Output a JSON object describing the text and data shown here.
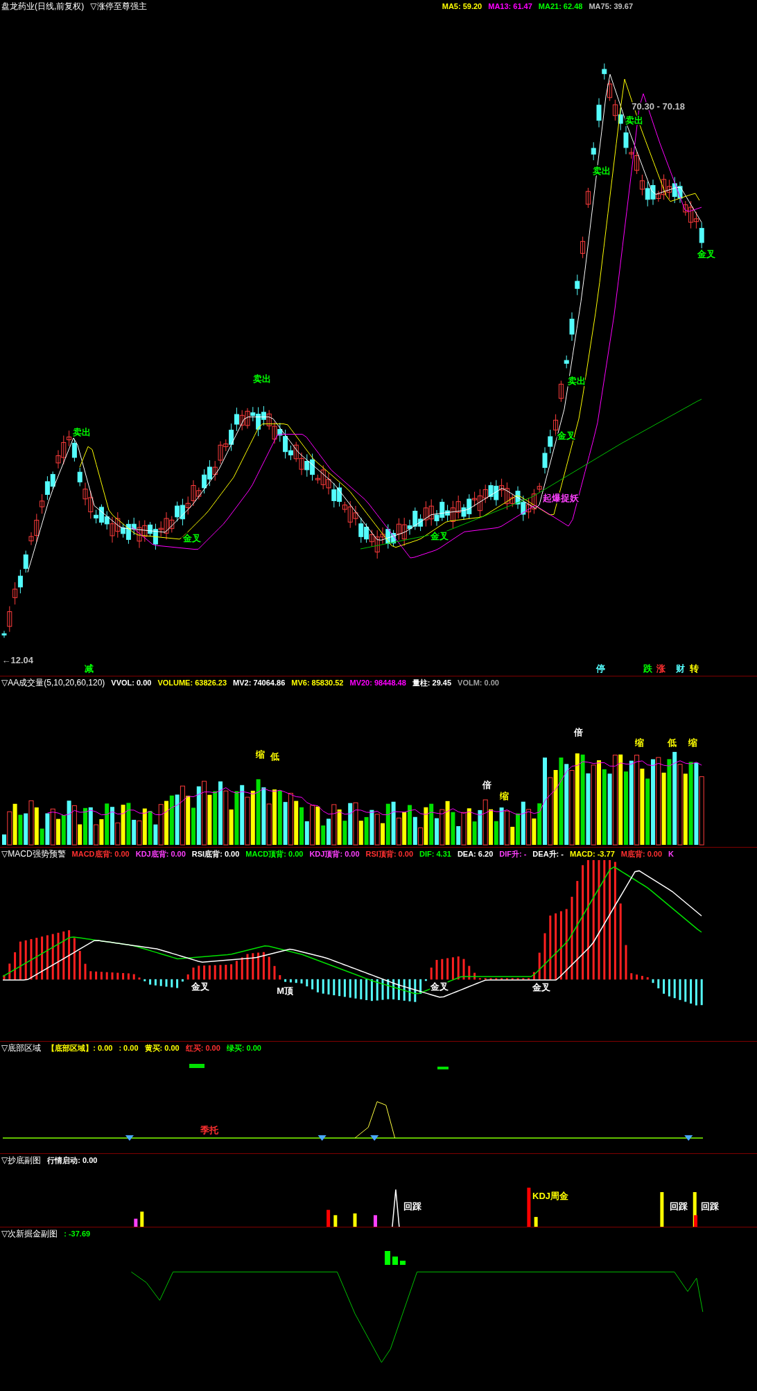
{
  "main_chart": {
    "title": "盘龙药业(日线,前复权)",
    "indicator": "▽涨停至尊强主",
    "legend": [
      {
        "label": "MA5: 59.20",
        "color": "#ffff00"
      },
      {
        "label": "MA13: 61.47",
        "color": "#ff00ff"
      },
      {
        "label": "MA21: 62.48",
        "color": "#00ff00"
      },
      {
        "label": "MA75: 39.67",
        "color": "#c0c0c0"
      }
    ],
    "annotations": [
      {
        "text": "卖出",
        "color": "#00ff00"
      },
      {
        "text": "卖出",
        "color": "#00ff00"
      },
      {
        "text": "卖出",
        "color": "#00ff00"
      },
      {
        "text": "卖出",
        "color": "#00ff00"
      },
      {
        "text": "卖出",
        "color": "#00ff00"
      },
      {
        "text": "金叉",
        "color": "#00ff00"
      },
      {
        "text": "金叉",
        "color": "#00ff00"
      },
      {
        "text": "金叉",
        "color": "#00ff00"
      },
      {
        "text": "金叉",
        "color": "#00ff00"
      },
      {
        "text": "起爆捉妖",
        "color": "#ff40ff"
      },
      {
        "text": "70.30 - 70.18",
        "color": "#c0c0c0"
      },
      {
        "text": "←12.04",
        "color": "#c0c0c0"
      },
      {
        "text": "减",
        "color": "#00ff00"
      },
      {
        "text": "停",
        "color": "#54fcfc"
      },
      {
        "text": "跌",
        "color": "#00ff00"
      },
      {
        "text": "涨",
        "color": "#ff3030"
      },
      {
        "text": "财",
        "color": "#54fcfc"
      },
      {
        "text": "转",
        "color": "#ffff00"
      }
    ]
  },
  "panes": [
    {
      "kind": "volume",
      "title": "▽AA成交量(5,10,20,60,120)",
      "legend": [
        {
          "label": "VVOL: 0.00",
          "color": "#ffffff"
        },
        {
          "label": "VOLUME: 63826.23",
          "color": "#ffff00"
        },
        {
          "label": "MV2: 74064.86",
          "color": "#ffffff"
        },
        {
          "label": "MV6: 85830.52",
          "color": "#ffff00"
        },
        {
          "label": "MV20: 98448.48",
          "color": "#ff00ff"
        },
        {
          "label": "量柱: 29.45",
          "color": "#ffffff"
        },
        {
          "label": "VOLM: 0.00",
          "color": "#a0a0a0"
        }
      ],
      "annotations": [
        {
          "text": "倍",
          "color": "#ffffff"
        },
        {
          "text": "缩",
          "color": "#ffff00"
        },
        {
          "text": "缩",
          "color": "#ffff00"
        },
        {
          "text": "缩",
          "color": "#ffff00"
        },
        {
          "text": "倍",
          "color": "#ffffff"
        },
        {
          "text": "缩",
          "color": "#ffff00"
        },
        {
          "text": "低",
          "color": "#ffff00"
        },
        {
          "text": "低",
          "color": "#ffff00"
        }
      ]
    },
    {
      "kind": "macd",
      "title": "▽MACD强势预警",
      "legend": [
        {
          "label": "MACD底背: 0.00",
          "color": "#ff3030"
        },
        {
          "label": "KDJ底背: 0.00",
          "color": "#ff40ff"
        },
        {
          "label": "RSI底背: 0.00",
          "color": "#ffffff"
        },
        {
          "label": "MACD顶背: 0.00",
          "color": "#00ff00"
        },
        {
          "label": "KDJ顶背: 0.00",
          "color": "#ff40ff"
        },
        {
          "label": "RSI顶背: 0.00",
          "color": "#ff3030"
        },
        {
          "label": "DIF: 4.31",
          "color": "#00ff00"
        },
        {
          "label": "DEA: 6.20",
          "color": "#ffffff"
        },
        {
          "label": "DIF升: -",
          "color": "#ff40ff"
        },
        {
          "label": "DEA升: -",
          "color": "#ffffff"
        },
        {
          "label": "MACD: -3.77",
          "color": "#ffff00"
        },
        {
          "label": "M底背: 0.00",
          "color": "#ff3030"
        },
        {
          "label": "K",
          "color": "#ff40ff"
        }
      ],
      "annotations": [
        {
          "text": "金叉",
          "color": "#ffffff"
        },
        {
          "text": "M顶",
          "color": "#ffffff"
        },
        {
          "text": "金叉",
          "color": "#ffffff"
        },
        {
          "text": "金叉",
          "color": "#ffffff"
        }
      ]
    },
    {
      "kind": "bottom",
      "title": "▽底部区域",
      "legend": [
        {
          "label": "【底部区域】: 0.00",
          "color": "#ffff00"
        },
        {
          "label": ": 0.00",
          "color": "#ffff00"
        },
        {
          "label": "黄买: 0.00",
          "color": "#ffff00"
        },
        {
          "label": "红买: 0.00",
          "color": "#ff3030"
        },
        {
          "label": "绿买: 0.00",
          "color": "#00ff00"
        }
      ],
      "annotations": [
        {
          "text": "季托",
          "color": "#ff3030"
        }
      ]
    },
    {
      "kind": "dip",
      "title": "▽抄底副图",
      "legend": [
        {
          "label": "行情启动: 0.00",
          "color": "#ffffff"
        }
      ],
      "annotations": [
        {
          "text": "回踩",
          "color": "#ffffff"
        },
        {
          "text": "KDJ周金",
          "color": "#ffff00"
        },
        {
          "text": "回踩",
          "color": "#ffffff"
        },
        {
          "text": "回踩",
          "color": "#ffffff"
        }
      ]
    },
    {
      "kind": "new",
      "title": "▽次新掘金副图",
      "legend": [
        {
          "label": ": -37.69",
          "color": "#00ff00"
        }
      ]
    }
  ]
}
